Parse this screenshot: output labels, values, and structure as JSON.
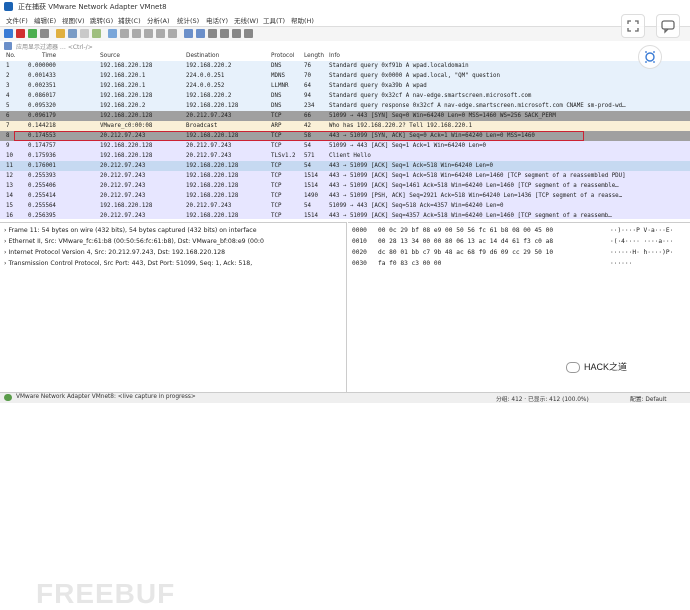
{
  "window": {
    "title": "正在捕获 VMware Network Adapter VMnet8"
  },
  "menu": [
    "文件(F)",
    "编辑(E)",
    "视图(V)",
    "跳转(G)",
    "捕获(C)",
    "分析(A)",
    "统计(S)",
    "电话(Y)",
    "无线(W)",
    "工具(T)",
    "帮助(H)"
  ],
  "filter": {
    "placeholder": "应用显示过滤器 … <Ctrl-/>"
  },
  "columns": [
    "No.",
    "Time",
    "Source",
    "Destination",
    "Protocol",
    "Length",
    "Info"
  ],
  "packets": [
    {
      "no": "1",
      "time": "0.000000",
      "src": "192.168.220.128",
      "dst": "192.168.220.2",
      "proto": "DNS",
      "len": "76",
      "info": "Standard query 0xf91b A wpad.localdomain",
      "bg": "#e7f1fb"
    },
    {
      "no": "2",
      "time": "0.001433",
      "src": "192.168.220.1",
      "dst": "224.0.0.251",
      "proto": "MDNS",
      "len": "70",
      "info": "Standard query 0x0000 A wpad.local, \"QM\" question",
      "bg": "#e7f1fb"
    },
    {
      "no": "3",
      "time": "0.002351",
      "src": "192.168.220.1",
      "dst": "224.0.0.252",
      "proto": "LLMNR",
      "len": "64",
      "info": "Standard query 0xa39b A wpad",
      "bg": "#e7f1fb"
    },
    {
      "no": "4",
      "time": "0.086017",
      "src": "192.168.220.128",
      "dst": "192.168.220.2",
      "proto": "DNS",
      "len": "94",
      "info": "Standard query 0x32cf A nav-edge.smartscreen.microsoft.com",
      "bg": "#e7f1fb"
    },
    {
      "no": "5",
      "time": "0.095320",
      "src": "192.168.220.2",
      "dst": "192.168.220.128",
      "proto": "DNS",
      "len": "234",
      "info": "Standard query response 0x32cf A nav-edge.smartscreen.microsoft.com CNAME sm-prod-wd…",
      "bg": "#e7f1fb"
    },
    {
      "no": "6",
      "time": "0.096179",
      "src": "192.168.220.128",
      "dst": "20.212.97.243",
      "proto": "TCP",
      "len": "66",
      "info": "51099 → 443 [SYN] Seq=0 Win=64240 Len=0 MSS=1460 WS=256 SACK_PERM",
      "bg": "#a0a0a0"
    },
    {
      "no": "7",
      "time": "0.144218",
      "src": "VMware_c0:00:08",
      "dst": "Broadcast",
      "proto": "ARP",
      "len": "42",
      "info": "Who has 192.168.220.2? Tell 192.168.220.1",
      "bg": "#faf0d7"
    },
    {
      "no": "8",
      "time": "0.174553",
      "src": "20.212.97.243",
      "dst": "192.168.220.128",
      "proto": "TCP",
      "len": "58",
      "info": "443 → 51099 [SYN, ACK] Seq=0 Ack=1 Win=64240 Len=0 MSS=1460",
      "bg": "#a0a0a0"
    },
    {
      "no": "9",
      "time": "0.174757",
      "src": "192.168.220.128",
      "dst": "20.212.97.243",
      "proto": "TCP",
      "len": "54",
      "info": "51099 → 443 [ACK] Seq=1 Ack=1 Win=64240 Len=0",
      "bg": "#e7e6ff"
    },
    {
      "no": "10",
      "time": "0.175936",
      "src": "192.168.220.128",
      "dst": "20.212.97.243",
      "proto": "TLSv1.2",
      "len": "571",
      "info": "Client Hello",
      "bg": "#e7e6ff"
    },
    {
      "no": "11",
      "time": "0.176001",
      "src": "20.212.97.243",
      "dst": "192.168.220.128",
      "proto": "TCP",
      "len": "54",
      "info": "443 → 51099 [ACK] Seq=1 Ack=518 Win=64240 Len=0",
      "bg": "#c6d9f1"
    },
    {
      "no": "12",
      "time": "0.255393",
      "src": "20.212.97.243",
      "dst": "192.168.220.128",
      "proto": "TCP",
      "len": "1514",
      "info": "443 → 51099 [ACK] Seq=1 Ack=518 Win=64240 Len=1460 [TCP segment of a reassembled PDU]",
      "bg": "#e7e6ff"
    },
    {
      "no": "13",
      "time": "0.255406",
      "src": "20.212.97.243",
      "dst": "192.168.220.128",
      "proto": "TCP",
      "len": "1514",
      "info": "443 → 51099 [ACK] Seq=1461 Ack=518 Win=64240 Len=1460 [TCP segment of a reassemble…",
      "bg": "#e7e6ff"
    },
    {
      "no": "14",
      "time": "0.255414",
      "src": "20.212.97.243",
      "dst": "192.168.220.128",
      "proto": "TCP",
      "len": "1490",
      "info": "443 → 51099 [PSH, ACK] Seq=2921 Ack=518 Win=64240 Len=1436 [TCP segment of a reasse…",
      "bg": "#e7e6ff"
    },
    {
      "no": "15",
      "time": "0.255564",
      "src": "192.168.220.128",
      "dst": "20.212.97.243",
      "proto": "TCP",
      "len": "54",
      "info": "51099 → 443 [ACK] Seq=518 Ack=4357 Win=64240 Len=0",
      "bg": "#e7e6ff"
    },
    {
      "no": "16",
      "time": "0.256395",
      "src": "20.212.97.243",
      "dst": "192.168.220.128",
      "proto": "TCP",
      "len": "1514",
      "info": "443 → 51099 [ACK] Seq=4357 Ack=518 Win=64240 Len=1460 [TCP segment of a reassemb…",
      "bg": "#e7e6ff"
    }
  ],
  "details": [
    "Frame 11: 54 bytes on wire (432 bits), 54 bytes captured (432 bits) on interface",
    "Ethernet II, Src: VMware_fc:61:b8 (00:50:56:fc:61:b8), Dst: VMware_bf:08:e9 (00:0",
    "Internet Protocol Version 4, Src: 20.212.97.243, Dst: 192.168.220.128",
    "Transmission Control Protocol, Src Port: 443, Dst Port: 51099, Seq: 1, Ack: 518,"
  ],
  "hex": [
    {
      "off": "0000",
      "bytes": "00 0c 29 bf 08 e9 00 50  56 fc 61 b8 08 00 45 00",
      "ascii": "··)····P V·a···E·"
    },
    {
      "off": "0010",
      "bytes": "00 28 13 34 00 00 80 06  13 ac 14 d4 61 f3 c0 a8",
      "ascii": "·(·4···· ····a···"
    },
    {
      "off": "0020",
      "bytes": "dc 80 01 bb c7 9b 48 ac  68 f9 d6 09 cc 29 50 10",
      "ascii": "······H· h····)P·"
    },
    {
      "off": "0030",
      "bytes": "fa f0 83 c3 00 00",
      "ascii": "······"
    }
  ],
  "status": {
    "left": "VMware Network Adapter VMnet8: <live capture in progress>",
    "right": "分组: 412 · 已显示: 412 (100.0%)",
    "profile": "配置: Default"
  },
  "watermark": "FREEBUF",
  "badge": "HACK之道"
}
